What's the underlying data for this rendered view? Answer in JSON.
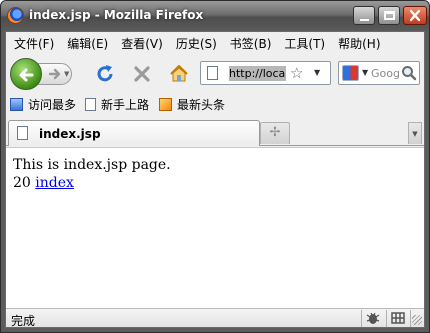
{
  "window": {
    "title": "index.jsp - Mozilla Firefox"
  },
  "menu": {
    "items": [
      {
        "label": "文件(F)"
      },
      {
        "label": "编辑(E)"
      },
      {
        "label": "查看(V)"
      },
      {
        "label": "历史(S)"
      },
      {
        "label": "书签(B)"
      },
      {
        "label": "工具(T)"
      },
      {
        "label": "帮助(H)"
      }
    ]
  },
  "navbar": {
    "url": "http://locall",
    "search_placeholder": "Goog"
  },
  "bookmarks": {
    "items": [
      {
        "label": "访问最多",
        "icon": "bookmark-folder-icon"
      },
      {
        "label": "新手上路",
        "icon": "page-icon"
      },
      {
        "label": "最新头条",
        "icon": "rss-feed-icon"
      }
    ]
  },
  "tabs": {
    "active_label": "index.jsp"
  },
  "page": {
    "line1": "This is index.jsp page.",
    "line2_number": "20",
    "link_text": "index"
  },
  "status": {
    "text": "完成"
  },
  "colors": {
    "link": "#0000ee",
    "titlebar": "#5c5c5c",
    "chrome": "#efeff0"
  }
}
